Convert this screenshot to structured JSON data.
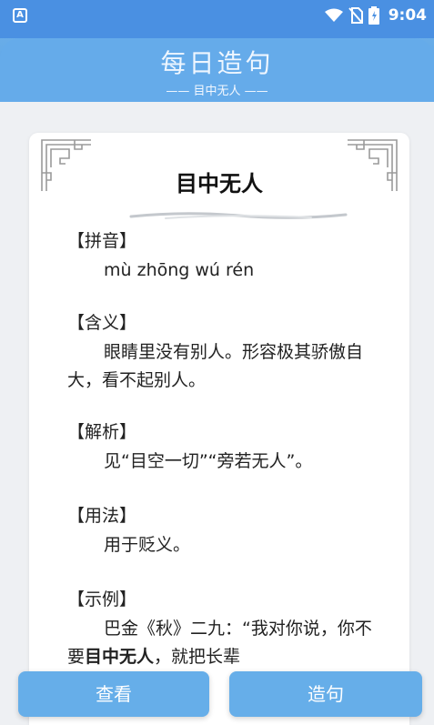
{
  "status_bar": {
    "time": "9:04",
    "app_icon_letter": "A"
  },
  "header": {
    "title": "每日造句",
    "subtitle": "—— 目中无人 ——"
  },
  "card": {
    "word": "目中无人",
    "sections": {
      "pinyin": {
        "label": "【拼音】",
        "text": "mù zhōng wú rén"
      },
      "meaning": {
        "label": "【含义】",
        "text": "眼睛里没有别人。形容极其骄傲自大，看不起别人。"
      },
      "analysis": {
        "label": "【解析】",
        "text": "见“目空一切”“旁若无人”。"
      },
      "usage": {
        "label": "【用法】",
        "text": "用于贬义。"
      },
      "example": {
        "label": "【示例】",
        "text_before": "巴金《秋》二九：“我对你说，你不要",
        "highlight": "目中无人",
        "text_after": "，就把长辈"
      }
    }
  },
  "buttons": {
    "view": "查看",
    "make_sentence": "造句"
  },
  "colors": {
    "primary": "#4a90e2",
    "header": "#65abea",
    "button": "#66aee9"
  }
}
